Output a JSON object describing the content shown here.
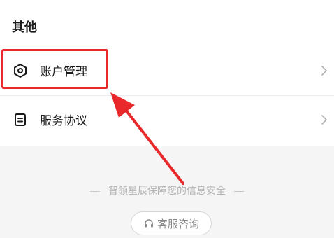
{
  "section": {
    "title": "其他"
  },
  "items": [
    {
      "label": "账户管理",
      "icon": "hexagon-settings-icon"
    },
    {
      "label": "服务协议",
      "icon": "document-icon"
    }
  ],
  "footer": {
    "note": "智领星辰保障您的信息安全",
    "consult_label": "客服咨询",
    "consult_icon": "headset-icon"
  },
  "colors": {
    "highlight": "#e8282b",
    "muted_text": "#b3b3b3",
    "background": "#f5f5f5"
  }
}
